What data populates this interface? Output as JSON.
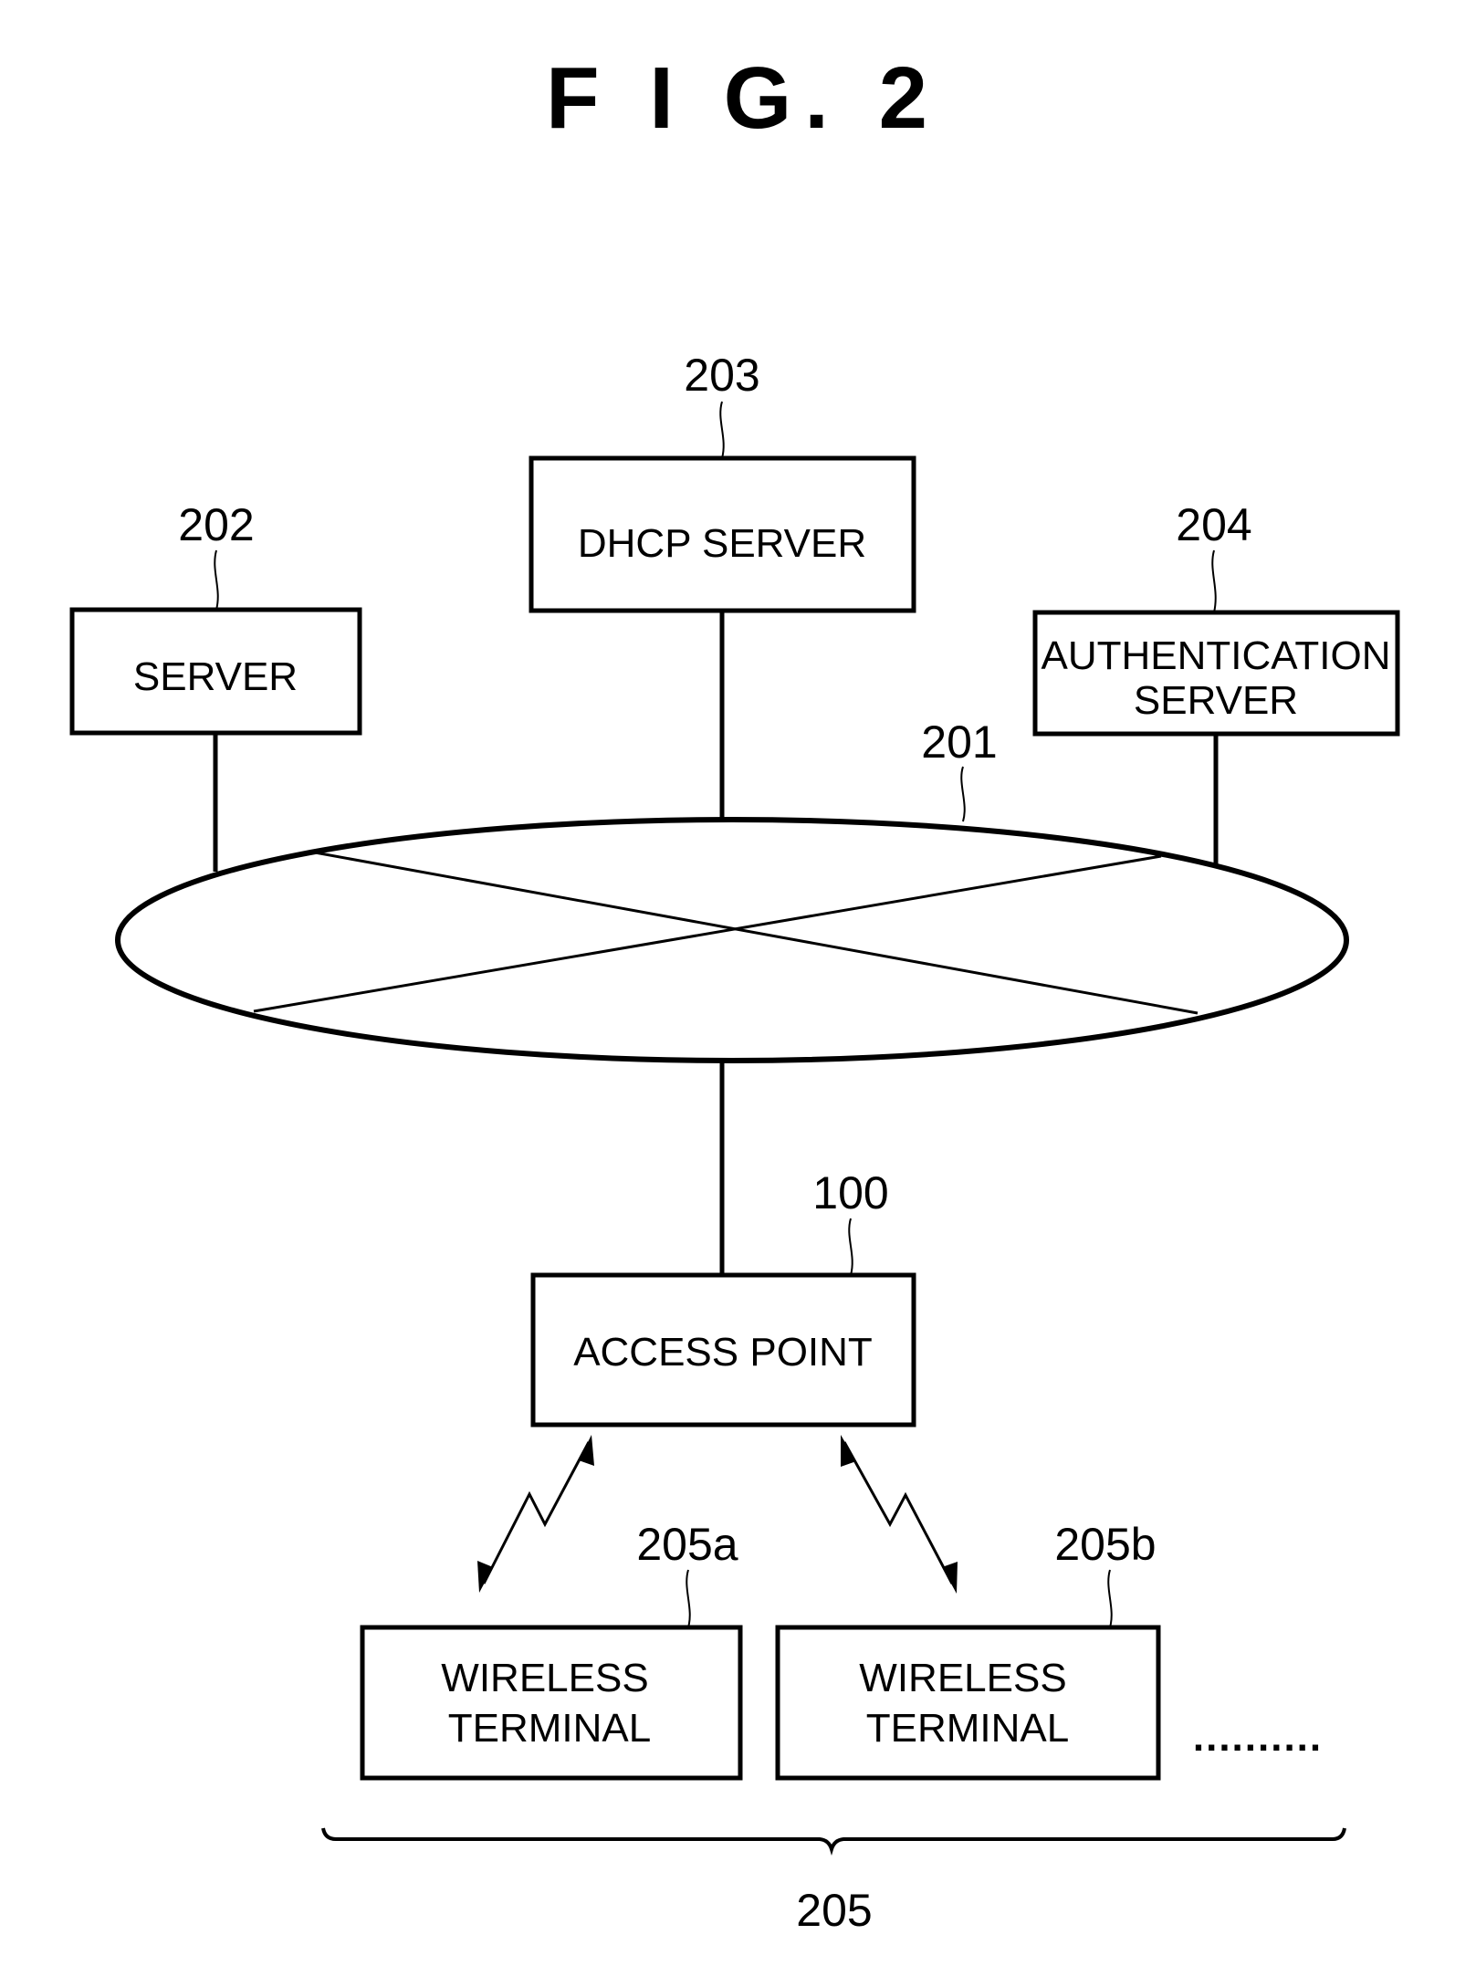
{
  "figure": {
    "title": "F I G.  2"
  },
  "nodes": {
    "dhcp_server": {
      "ref": "203",
      "label": "DHCP SERVER"
    },
    "server": {
      "ref": "202",
      "label": "SERVER"
    },
    "auth_server": {
      "ref": "204",
      "label_line1": "AUTHENTICATION",
      "label_line2": "SERVER"
    },
    "network": {
      "ref": "201"
    },
    "access_point": {
      "ref": "100",
      "label": "ACCESS POINT"
    },
    "terminal_a": {
      "ref": "205a",
      "label_line1": "WIRELESS",
      "label_line2": "TERMINAL"
    },
    "terminal_b": {
      "ref": "205b",
      "label_line1": "WIRELESS",
      "label_line2": "TERMINAL"
    },
    "more_terminals": {
      "label": ".........."
    },
    "terminal_group": {
      "ref": "205"
    }
  }
}
